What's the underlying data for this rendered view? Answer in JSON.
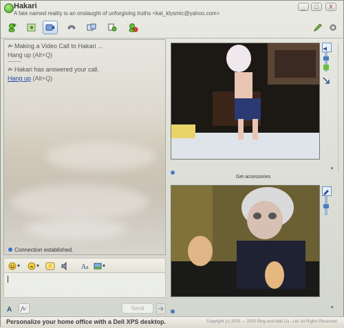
{
  "window": {
    "title": "Hakari",
    "subtitle": "A fate named reality is an onslaught of unforgiving truths <kat_klysmic@yahoo.com>",
    "controls": [
      "_",
      "□",
      "X"
    ]
  },
  "toolbar": {
    "items": [
      "invite-icon",
      "send-files-icon",
      "webcam-icon",
      "call-icon",
      "activities-icon",
      "games-icon",
      "block-icon"
    ],
    "right_items": [
      "pen-icon",
      "settings-icon"
    ]
  },
  "chat": {
    "messages": [
      {
        "text": "Making a Video Call to Hakari ...",
        "action": "Hang up",
        "shortcut": "(Alt+Q)",
        "action_active": false
      },
      {
        "text": "Hakari has answered your call.",
        "action": "Hang up",
        "shortcut": "(Alt+Q)",
        "action_active": true
      }
    ],
    "status": "Connection established."
  },
  "compose": {
    "value": "",
    "send_label": "Send"
  },
  "video": {
    "accessories_label": "Get accessories"
  },
  "statusbar": {
    "ad_text": "Personalize your home office with a Dell XPS desktop.",
    "copyright": "Copyright (c) 2003 — 2005 Ring-and-Mail Co., Ltd. All Rights Reserved."
  },
  "colors": {
    "link": "#2244aa",
    "accent": "#3f9a1f"
  }
}
